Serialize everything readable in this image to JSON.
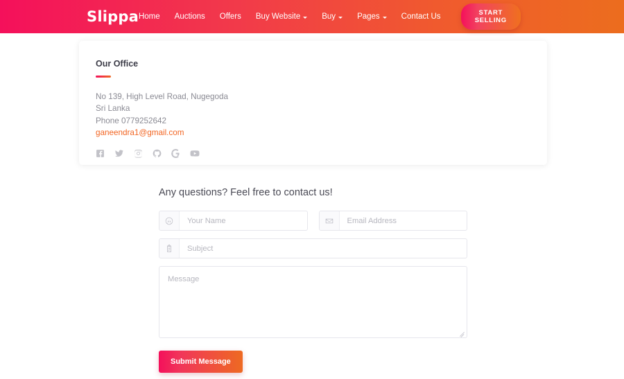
{
  "header": {
    "brand": "Slippa",
    "nav": [
      {
        "label": "Home",
        "has_caret": false
      },
      {
        "label": "Auctions",
        "has_caret": false
      },
      {
        "label": "Offers",
        "has_caret": false
      },
      {
        "label": "Buy Website",
        "has_caret": true
      },
      {
        "label": "Buy",
        "has_caret": true
      },
      {
        "label": "Pages",
        "has_caret": true
      },
      {
        "label": "Contact Us",
        "has_caret": false
      }
    ],
    "cta_label": "START SELLING",
    "gradient_start": "#f4105b",
    "gradient_end": "#ec6d1e"
  },
  "office": {
    "title": "Our Office",
    "address_line1": "No 139, High Level Road, Nugegoda",
    "address_line2": "Sri Lanka",
    "phone": "Phone 0779252642",
    "email": "ganeendra1@gmail.com",
    "email_color": "#f26522",
    "socials": [
      {
        "name": "facebook-icon"
      },
      {
        "name": "twitter-icon"
      },
      {
        "name": "instagram-icon"
      },
      {
        "name": "github-icon"
      },
      {
        "name": "google-icon"
      },
      {
        "name": "youtube-icon"
      }
    ]
  },
  "form": {
    "heading": "Any questions? Feel free to contact us!",
    "name": {
      "placeholder": "Your Name",
      "value": "",
      "icon": "user-icon"
    },
    "email": {
      "placeholder": "Email Address",
      "value": "",
      "icon": "envelope-icon"
    },
    "subject": {
      "placeholder": "Subject",
      "value": "",
      "icon": "clipboard-icon"
    },
    "message": {
      "placeholder": "Message",
      "value": ""
    },
    "submit_label": "Submit Message"
  }
}
